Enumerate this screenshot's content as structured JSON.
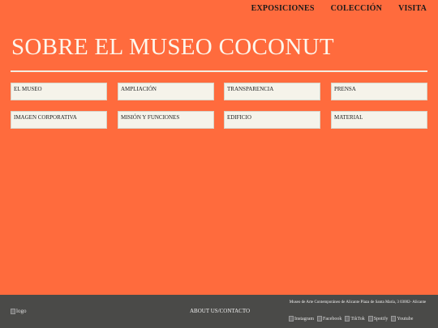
{
  "nav": {
    "items": [
      "EXPOSICIONES",
      "COLECCIÓN",
      "VISITA"
    ]
  },
  "page": {
    "title": "SOBRE EL MUSEO COCONUT"
  },
  "tiles": [
    "EL MUSEO",
    "AMPLIACIÓN",
    "TRANSPARENCIA",
    "PRENSA",
    "IMAGEN CORPORATIVA",
    "MISIÓN Y FUNCIONES",
    "EDIFICIO",
    "MATERIAL"
  ],
  "footer": {
    "logo_alt": "logo",
    "about": "ABOUT US/CONTACTO",
    "address": "Museo de Arte Contemporáneo de Alicante Plaza de Santa María, 3 03002- Alicante",
    "social": [
      "Instagram",
      "Facebook",
      "TikTok",
      "Spotify",
      "Youtube"
    ]
  },
  "colors": {
    "background": "#FF6B3D",
    "tile": "#F5F3EA",
    "footer": "#4a4a48"
  }
}
